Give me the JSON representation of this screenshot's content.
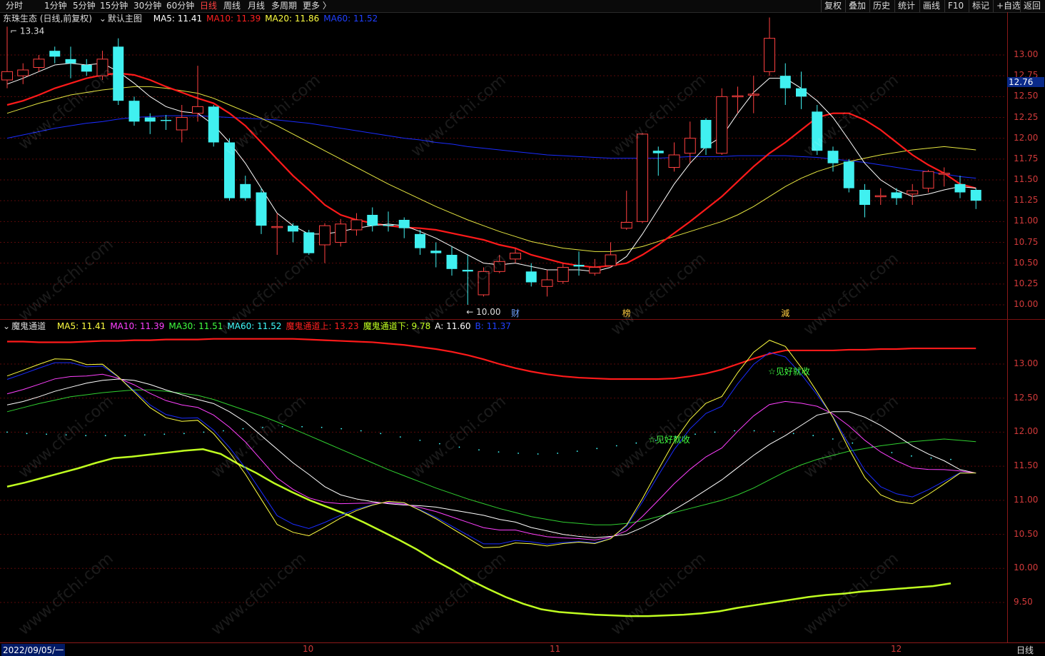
{
  "toolbar": {
    "tabs": [
      "分时",
      "1分钟",
      "5分钟",
      "15分钟",
      "30分钟",
      "60分钟",
      "日线",
      "周线",
      "月线",
      "多周期",
      "更多 〉"
    ],
    "active_tab": "日线",
    "right_buttons": [
      "复权",
      "叠加",
      "历史",
      "统计",
      "画线",
      "F10",
      "标记",
      "+自选",
      "返回"
    ]
  },
  "main": {
    "title": "东珠生态 (日线,前复权)",
    "template": "默认主图",
    "ma": [
      {
        "label": "MA5: 11.41",
        "color": "#ffffff"
      },
      {
        "label": "MA10: 11.39",
        "color": "#ff2020"
      },
      {
        "label": "MA20: 11.86",
        "color": "#ffff40"
      },
      {
        "label": "MA60: 11.52",
        "color": "#2040ff"
      }
    ],
    "high_label": "13.34",
    "low_label": "10.00",
    "current_price": "12.76",
    "y_ticks": [
      "13.00",
      "12.75",
      "12.50",
      "12.25",
      "12.00",
      "11.75",
      "11.50",
      "11.25",
      "11.00",
      "10.75",
      "10.50",
      "10.25",
      "10.00"
    ],
    "markers": [
      "财",
      "榜",
      "減"
    ]
  },
  "indicator": {
    "name": "魔鬼通道",
    "items": [
      {
        "label": "MA5: 11.41",
        "color": "#ffff40"
      },
      {
        "label": "MA10: 11.39",
        "color": "#ff40ff"
      },
      {
        "label": "MA30: 11.51",
        "color": "#40ff40"
      },
      {
        "label": "MA60: 11.52",
        "color": "#40ffff"
      },
      {
        "label": "魔鬼通道上: 13.23",
        "color": "#ff2020"
      },
      {
        "label": "魔鬼通道下: 9.78",
        "color": "#c0ff20"
      },
      {
        "label": "A: 11.60",
        "color": "#ffffff"
      },
      {
        "label": "B: 11.37",
        "color": "#2040ff"
      }
    ],
    "annotations": [
      "☆见好就收",
      "☆见好就收"
    ],
    "y_ticks": [
      "13.00",
      "12.50",
      "12.00",
      "11.50",
      "11.00",
      "10.50",
      "10.00",
      "9.50"
    ]
  },
  "x_axis": {
    "labels": [
      "2022/09/05/一",
      "10",
      "11",
      "12"
    ],
    "period": "日线"
  },
  "watermark": "www.cfchi.com",
  "chart_data": {
    "type": "candlestick",
    "candles": [
      {
        "o": 12.7,
        "c": 12.8,
        "h": 13.34,
        "l": 12.6
      },
      {
        "o": 12.75,
        "c": 12.82,
        "h": 12.9,
        "l": 12.65
      },
      {
        "o": 12.85,
        "c": 12.95,
        "h": 13.0,
        "l": 12.8
      },
      {
        "o": 13.05,
        "c": 12.98,
        "h": 13.1,
        "l": 12.9
      },
      {
        "o": 12.95,
        "c": 12.9,
        "h": 13.1,
        "l": 12.72
      },
      {
        "o": 12.88,
        "c": 12.8,
        "h": 12.95,
        "l": 12.75
      },
      {
        "o": 12.75,
        "c": 12.95,
        "h": 13.05,
        "l": 12.7
      },
      {
        "o": 13.1,
        "c": 12.45,
        "h": 13.2,
        "l": 12.4
      },
      {
        "o": 12.45,
        "c": 12.2,
        "h": 12.5,
        "l": 12.15
      },
      {
        "o": 12.25,
        "c": 12.2,
        "h": 12.3,
        "l": 12.05
      },
      {
        "o": 12.22,
        "c": 12.21,
        "h": 12.28,
        "l": 12.1
      },
      {
        "o": 12.1,
        "c": 12.25,
        "h": 12.4,
        "l": 11.95
      },
      {
        "o": 12.3,
        "c": 12.38,
        "h": 12.87,
        "l": 12.2
      },
      {
        "o": 12.38,
        "c": 11.95,
        "h": 12.4,
        "l": 11.9
      },
      {
        "o": 11.95,
        "c": 11.28,
        "h": 12.0,
        "l": 11.25
      },
      {
        "o": 11.45,
        "c": 11.28,
        "h": 11.55,
        "l": 11.25
      },
      {
        "o": 11.35,
        "c": 10.95,
        "h": 11.4,
        "l": 10.85
      },
      {
        "o": 10.93,
        "c": 10.94,
        "h": 11.1,
        "l": 10.6
      },
      {
        "o": 10.95,
        "c": 10.88,
        "h": 10.98,
        "l": 10.75
      },
      {
        "o": 10.87,
        "c": 10.62,
        "h": 10.9,
        "l": 10.6
      },
      {
        "o": 10.72,
        "c": 10.95,
        "h": 10.98,
        "l": 10.5
      },
      {
        "o": 10.75,
        "c": 10.97,
        "h": 11.03,
        "l": 10.7
      },
      {
        "o": 10.9,
        "c": 11.02,
        "h": 11.1,
        "l": 10.83
      },
      {
        "o": 11.08,
        "c": 10.95,
        "h": 11.17,
        "l": 10.88
      },
      {
        "o": 10.96,
        "c": 10.95,
        "h": 11.12,
        "l": 10.88
      },
      {
        "o": 11.02,
        "c": 10.92,
        "h": 11.05,
        "l": 10.8
      },
      {
        "o": 10.85,
        "c": 10.68,
        "h": 10.9,
        "l": 10.6
      },
      {
        "o": 10.65,
        "c": 10.62,
        "h": 10.75,
        "l": 10.45
      },
      {
        "o": 10.6,
        "c": 10.43,
        "h": 10.7,
        "l": 10.35
      },
      {
        "o": 10.42,
        "c": 10.4,
        "h": 10.6,
        "l": 10.0
      },
      {
        "o": 10.12,
        "c": 10.4,
        "h": 10.45,
        "l": 10.1
      },
      {
        "o": 10.4,
        "c": 10.52,
        "h": 10.6,
        "l": 10.38
      },
      {
        "o": 10.55,
        "c": 10.62,
        "h": 10.68,
        "l": 10.5
      },
      {
        "o": 10.4,
        "c": 10.27,
        "h": 10.5,
        "l": 10.22
      },
      {
        "o": 10.22,
        "c": 10.3,
        "h": 10.42,
        "l": 10.1
      },
      {
        "o": 10.28,
        "c": 10.45,
        "h": 10.5,
        "l": 10.25
      },
      {
        "o": 10.48,
        "c": 10.46,
        "h": 10.64,
        "l": 10.35
      },
      {
        "o": 10.38,
        "c": 10.45,
        "h": 10.55,
        "l": 10.35
      },
      {
        "o": 10.47,
        "c": 10.6,
        "h": 10.75,
        "l": 10.45
      },
      {
        "o": 10.92,
        "c": 10.99,
        "h": 11.37,
        "l": 10.9
      },
      {
        "o": 11.0,
        "c": 12.05,
        "h": 12.06,
        "l": 10.98
      },
      {
        "o": 11.85,
        "c": 11.82,
        "h": 11.9,
        "l": 11.55
      },
      {
        "o": 11.65,
        "c": 11.8,
        "h": 11.95,
        "l": 11.6
      },
      {
        "o": 11.82,
        "c": 12.0,
        "h": 12.2,
        "l": 11.7
      },
      {
        "o": 12.22,
        "c": 11.88,
        "h": 12.24,
        "l": 11.8
      },
      {
        "o": 11.82,
        "c": 12.5,
        "h": 12.6,
        "l": 11.8
      },
      {
        "o": 12.5,
        "c": 12.51,
        "h": 12.62,
        "l": 12.3
      },
      {
        "o": 12.53,
        "c": 12.53,
        "h": 12.75,
        "l": 12.3
      },
      {
        "o": 12.8,
        "c": 13.2,
        "h": 13.45,
        "l": 12.75
      },
      {
        "o": 12.75,
        "c": 12.6,
        "h": 12.9,
        "l": 12.4
      },
      {
        "o": 12.6,
        "c": 12.5,
        "h": 12.8,
        "l": 12.35
      },
      {
        "o": 12.32,
        "c": 11.85,
        "h": 12.4,
        "l": 11.8
      },
      {
        "o": 11.85,
        "c": 11.7,
        "h": 11.9,
        "l": 11.6
      },
      {
        "o": 11.72,
        "c": 11.4,
        "h": 11.75,
        "l": 11.35
      },
      {
        "o": 11.38,
        "c": 11.2,
        "h": 11.45,
        "l": 11.05
      },
      {
        "o": 11.3,
        "c": 11.31,
        "h": 11.4,
        "l": 11.2
      },
      {
        "o": 11.35,
        "c": 11.28,
        "h": 11.4,
        "l": 11.2
      },
      {
        "o": 11.33,
        "c": 11.37,
        "h": 11.45,
        "l": 11.2
      },
      {
        "o": 11.4,
        "c": 11.6,
        "h": 11.62,
        "l": 11.35
      },
      {
        "o": 11.58,
        "c": 11.58,
        "h": 11.65,
        "l": 11.42
      },
      {
        "o": 11.45,
        "c": 11.35,
        "h": 11.55,
        "l": 11.28
      },
      {
        "o": 11.38,
        "c": 11.25,
        "h": 11.4,
        "l": 11.15
      }
    ],
    "ma5": [
      12.65,
      12.72,
      12.8,
      12.88,
      12.9,
      12.88,
      12.9,
      12.8,
      12.66,
      12.5,
      12.38,
      12.32,
      12.3,
      12.16,
      11.95,
      11.7,
      11.4,
      11.1,
      10.95,
      10.85,
      10.85,
      10.88,
      10.92,
      10.95,
      10.97,
      10.95,
      10.88,
      10.8,
      10.7,
      10.6,
      10.5,
      10.48,
      10.5,
      10.46,
      10.42,
      10.42,
      10.42,
      10.4,
      10.45,
      10.58,
      10.85,
      11.15,
      11.45,
      11.7,
      11.9,
      12.02,
      12.3,
      12.55,
      12.72,
      12.72,
      12.6,
      12.45,
      12.25,
      11.98,
      11.7,
      11.5,
      11.38,
      11.3,
      11.33,
      11.38,
      11.42,
      11.4
    ],
    "ma10": [
      12.4,
      12.45,
      12.52,
      12.6,
      12.66,
      12.72,
      12.76,
      12.78,
      12.76,
      12.7,
      12.62,
      12.55,
      12.48,
      12.42,
      12.3,
      12.15,
      11.95,
      11.75,
      11.55,
      11.38,
      11.2,
      11.08,
      11.02,
      10.98,
      10.95,
      10.93,
      10.92,
      10.9,
      10.86,
      10.82,
      10.78,
      10.72,
      10.68,
      10.6,
      10.55,
      10.5,
      10.47,
      10.45,
      10.47,
      10.5,
      10.6,
      10.72,
      10.86,
      11.0,
      11.15,
      11.3,
      11.48,
      11.66,
      11.82,
      11.95,
      12.1,
      12.25,
      12.3,
      12.3,
      12.22,
      12.1,
      11.95,
      11.8,
      11.68,
      11.58,
      11.45,
      11.4
    ],
    "ma20": [
      12.3,
      12.36,
      12.42,
      12.47,
      12.52,
      12.55,
      12.58,
      12.6,
      12.62,
      12.62,
      12.6,
      12.57,
      12.54,
      12.48,
      12.4,
      12.32,
      12.24,
      12.15,
      12.05,
      11.95,
      11.85,
      11.75,
      11.65,
      11.55,
      11.45,
      11.36,
      11.27,
      11.18,
      11.1,
      11.02,
      10.95,
      10.88,
      10.82,
      10.76,
      10.72,
      10.68,
      10.66,
      10.64,
      10.64,
      10.66,
      10.7,
      10.76,
      10.82,
      10.88,
      10.94,
      11.0,
      11.08,
      11.18,
      11.3,
      11.42,
      11.52,
      11.6,
      11.66,
      11.72,
      11.76,
      11.8,
      11.83,
      11.86,
      11.88,
      11.9,
      11.88,
      11.86
    ],
    "ma60": [
      12.0,
      12.04,
      12.08,
      12.12,
      12.15,
      12.18,
      12.2,
      12.23,
      12.25,
      12.26,
      12.27,
      12.27,
      12.27,
      12.26,
      12.25,
      12.24,
      12.23,
      12.22,
      12.2,
      12.18,
      12.15,
      12.12,
      12.09,
      12.06,
      12.03,
      12.0,
      11.98,
      11.95,
      11.93,
      11.9,
      11.88,
      11.86,
      11.84,
      11.82,
      11.8,
      11.79,
      11.78,
      11.77,
      11.76,
      11.76,
      11.76,
      11.76,
      11.77,
      11.78,
      11.78,
      11.78,
      11.79,
      11.79,
      11.79,
      11.79,
      11.78,
      11.77,
      11.75,
      11.73,
      11.71,
      11.68,
      11.65,
      11.62,
      11.6,
      11.57,
      11.54,
      11.52
    ],
    "channel_upper": [
      13.33,
      13.33,
      13.32,
      13.32,
      13.32,
      13.33,
      13.34,
      13.34,
      13.35,
      13.35,
      13.36,
      13.36,
      13.36,
      13.37,
      13.37,
      13.37,
      13.37,
      13.37,
      13.37,
      13.36,
      13.35,
      13.34,
      13.33,
      13.32,
      13.3,
      13.28,
      13.25,
      13.22,
      13.18,
      13.13,
      13.07,
      13.0,
      12.94,
      12.89,
      12.85,
      12.82,
      12.8,
      12.79,
      12.78,
      12.78,
      12.78,
      12.78,
      12.79,
      12.82,
      12.86,
      12.92,
      13.0,
      13.08,
      13.15,
      13.2,
      13.2,
      13.2,
      13.2,
      13.21,
      13.21,
      13.22,
      13.22,
      13.23,
      13.23,
      13.23,
      13.23,
      13.23
    ],
    "channel_lower": [
      11.2,
      11.26,
      11.33,
      11.4,
      11.47,
      11.55,
      11.62,
      11.64,
      11.67,
      11.7,
      11.73,
      11.75,
      11.68,
      11.53,
      11.4,
      11.25,
      11.12,
      11.0,
      10.9,
      10.8,
      10.68,
      10.55,
      10.42,
      10.28,
      10.12,
      9.98,
      9.83,
      9.7,
      9.58,
      9.48,
      9.4,
      9.36,
      9.34,
      9.32,
      9.31,
      9.3,
      9.3,
      9.31,
      9.32,
      9.34,
      9.37,
      9.42,
      9.46,
      9.5,
      9.54,
      9.58,
      9.61,
      9.63,
      9.66,
      9.68,
      9.7,
      9.72,
      9.74,
      9.78
    ],
    "channel_mid": [
      12.0,
      11.98,
      11.97,
      11.96,
      11.95,
      11.95,
      11.95,
      11.96,
      11.97,
      11.98,
      12.0,
      12.02,
      12.05,
      12.07,
      12.08,
      12.08,
      12.07,
      12.05,
      12.02,
      11.98,
      11.93,
      11.88,
      11.83,
      11.78,
      11.74,
      11.71,
      11.69,
      11.68,
      11.69,
      11.72,
      11.76,
      11.8,
      11.84,
      11.88,
      11.93,
      11.97,
      12.0,
      12.02,
      12.02,
      12.01,
      11.98,
      11.95,
      11.9,
      11.84,
      11.78,
      11.7,
      11.65,
      11.62,
      11.6
    ]
  }
}
